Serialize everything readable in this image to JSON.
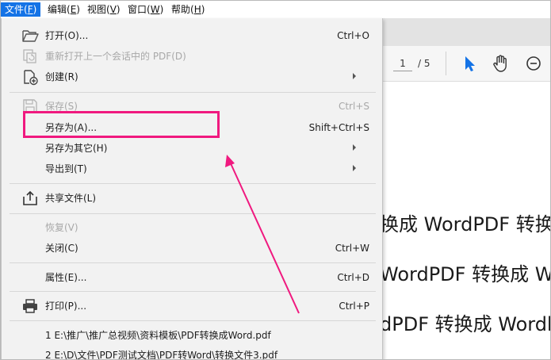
{
  "menubar": {
    "items": [
      {
        "text": "文件(",
        "key": "F",
        "close": ")"
      },
      {
        "text": "编辑(",
        "key": "E",
        "close": ")"
      },
      {
        "text": "视图(",
        "key": "V",
        "close": ")"
      },
      {
        "text": "窗口(",
        "key": "W",
        "close": ")"
      },
      {
        "text": "帮助(",
        "key": "H",
        "close": ")"
      }
    ]
  },
  "toolbar": {
    "page_current": "1",
    "page_total": "/ 5"
  },
  "document": {
    "lines": [
      "换成 WordPDF 转换成",
      "WordPDF 转换成 Wo",
      "dPDF 转换成 Wordl"
    ]
  },
  "menu": {
    "open": {
      "label": "打开(O)...",
      "shortcut": "Ctrl+O"
    },
    "reopen": {
      "label": "重新打开上一个会话中的 PDF(D)"
    },
    "create": {
      "label": "创建(R)"
    },
    "save": {
      "label": "保存(S)",
      "shortcut": "Ctrl+S"
    },
    "save_as": {
      "label": "另存为(A)...",
      "shortcut": "Shift+Ctrl+S"
    },
    "save_as_other": {
      "label": "另存为其它(H)"
    },
    "export_to": {
      "label": "导出到(T)"
    },
    "share_file": {
      "label": "共享文件(L)"
    },
    "revert": {
      "label": "恢复(V)"
    },
    "close": {
      "label": "关闭(C)",
      "shortcut": "Ctrl+W"
    },
    "properties": {
      "label": "属性(E)...",
      "shortcut": "Ctrl+D"
    },
    "print": {
      "label": "打印(P)...",
      "shortcut": "Ctrl+P"
    },
    "recent_files": [
      "1 E:\\推广\\推广总视频\\资料模板\\PDF转换成Word.pdf",
      "2 E:\\D\\文件\\PDF测试文档\\PDF转Word\\转换文件3.pdf"
    ]
  },
  "colors": {
    "accent": "#1473e6",
    "highlight": "#f0197f",
    "menu_bg": "#f2f2f2",
    "disabled_text": "#a8a8a8"
  }
}
